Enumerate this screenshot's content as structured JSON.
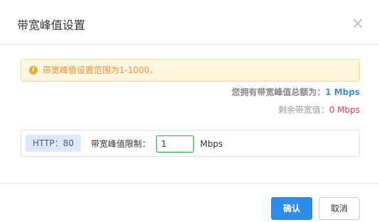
{
  "dialog": {
    "title": "带宽峰值设置",
    "close_icon": "close-icon"
  },
  "notice": {
    "icon": "info-icon",
    "icon_glyph": "i",
    "text": "带宽峰值设置范围为1-1000。",
    "color": "#e8923a"
  },
  "summary": {
    "total_label": "您拥有带宽峰值总额为：",
    "total_value": "1 Mbps",
    "remain_label": "剩余带宽值：",
    "remain_value": "0 Mbps"
  },
  "limit_row": {
    "protocol_tag": "HTTP：80",
    "label": "带宽峰值限制：",
    "input_value": "1",
    "unit": "Mbps"
  },
  "footer": {
    "confirm_label": "确认",
    "cancel_label": "取消"
  },
  "colors": {
    "accent": "#2c8ee6",
    "total_value": "#3f90dd",
    "remain_value": "#e03c46",
    "input_border": "#35a63d"
  }
}
